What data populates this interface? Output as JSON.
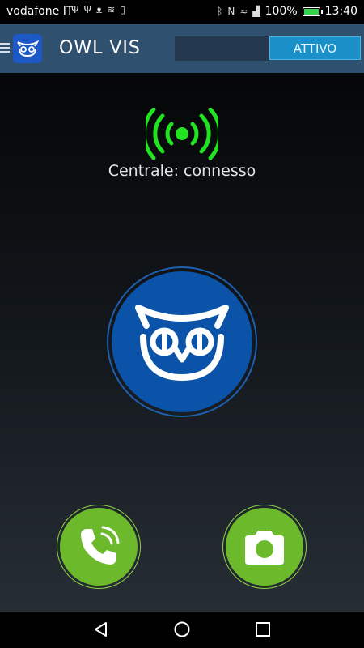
{
  "statusbar": {
    "carrier": "vodafone IT",
    "battery": "100%",
    "time": "13:40",
    "icons": [
      "usb-icon",
      "usb-icon",
      "owl-notification-icon",
      "sound-icon",
      "sdcard-icon",
      "bluetooth-icon",
      "nfc-icon",
      "wifi-icon",
      "signal-bars-icon"
    ]
  },
  "appbar": {
    "title": "OWL VIS",
    "status_button": "ATTIVO"
  },
  "main": {
    "connection_status": "Centrale: connesso"
  },
  "colors": {
    "appbar_bg": "#2f506f",
    "status_button_bg": "#1b8fc8",
    "signal_green": "#22e322",
    "owl_blue": "#0a53a8",
    "action_green": "#6cba2c"
  }
}
